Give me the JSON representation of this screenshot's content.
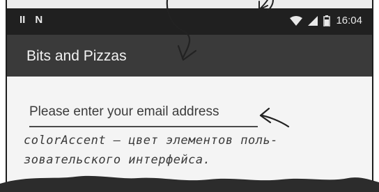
{
  "status_bar": {
    "left_glyphs": [
      "II",
      "N"
    ],
    "time": "16:04"
  },
  "app_bar": {
    "title": "Bits and Pizzas"
  },
  "email_field": {
    "text": "Please enter your email address"
  },
  "annotation": {
    "line1": "colorAccent — цвет элементов поль-",
    "line2": "зовательского интерфейса."
  },
  "colors": {
    "app_bar": "#3a3a3a",
    "status_bar": "#202020",
    "accent": "#4a4a4a"
  }
}
